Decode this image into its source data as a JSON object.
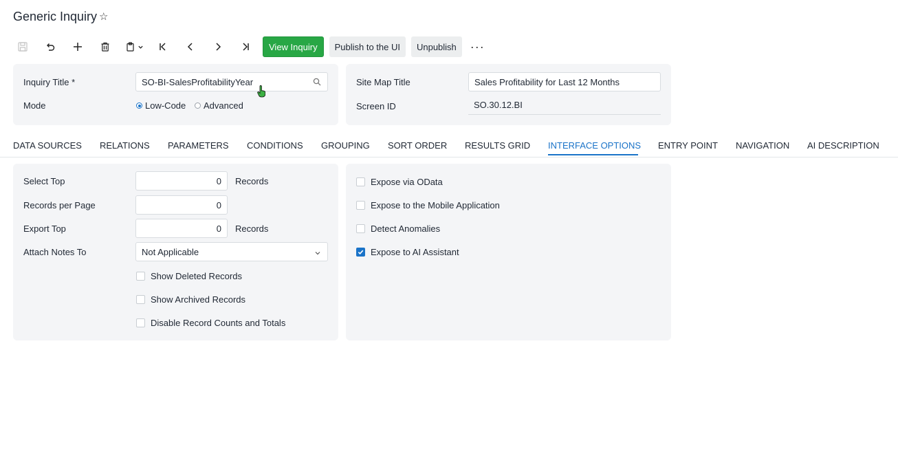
{
  "page": {
    "title": "Generic Inquiry"
  },
  "toolbar": {
    "icons": [
      "save-icon",
      "undo-icon",
      "add-icon",
      "delete-icon",
      "copy-paste-icon",
      "first-record-icon",
      "previous-record-icon",
      "next-record-icon",
      "last-record-icon"
    ],
    "view_inquiry": "View Inquiry",
    "publish": "Publish to the UI",
    "unpublish": "Unpublish",
    "more": "···"
  },
  "header_form": {
    "inquiry_title_label": "Inquiry Title *",
    "inquiry_title_value": "SO-BI-SalesProfitabilityYear",
    "mode_label": "Mode",
    "mode_options": [
      "Low-Code",
      "Advanced"
    ],
    "mode_selected": "Low-Code",
    "site_map_title_label": "Site Map Title",
    "site_map_title_value": "Sales Profitability for Last 12 Months",
    "screen_id_label": "Screen ID",
    "screen_id_value": "SO.30.12.BI"
  },
  "tabs": [
    {
      "label": "DATA SOURCES"
    },
    {
      "label": "RELATIONS"
    },
    {
      "label": "PARAMETERS"
    },
    {
      "label": "CONDITIONS"
    },
    {
      "label": "GROUPING"
    },
    {
      "label": "SORT ORDER"
    },
    {
      "label": "RESULTS GRID"
    },
    {
      "label": "INTERFACE OPTIONS"
    },
    {
      "label": "ENTRY POINT"
    },
    {
      "label": "NAVIGATION"
    },
    {
      "label": "AI DESCRIPTION"
    }
  ],
  "active_tab": "INTERFACE OPTIONS",
  "interface_options": {
    "select_top_label": "Select Top",
    "select_top_value": "0",
    "select_top_unit": "Records",
    "records_per_page_label": "Records per Page",
    "records_per_page_value": "0",
    "export_top_label": "Export Top",
    "export_top_value": "0",
    "export_top_unit": "Records",
    "attach_notes_label": "Attach Notes To",
    "attach_notes_value": "Not Applicable",
    "checkboxes_left": [
      {
        "label": "Show Deleted Records",
        "checked": false
      },
      {
        "label": "Show Archived Records",
        "checked": false
      },
      {
        "label": "Disable Record Counts and Totals",
        "checked": false
      }
    ],
    "checkboxes_right": [
      {
        "label": "Expose via OData",
        "checked": false
      },
      {
        "label": "Expose to the Mobile Application",
        "checked": false
      },
      {
        "label": "Detect Anomalies",
        "checked": false
      },
      {
        "label": "Expose to AI Assistant",
        "checked": true
      }
    ]
  },
  "colors": {
    "accent": "#1a73c8",
    "primary_button": "#28a745",
    "panel_bg": "#f4f5f7"
  }
}
